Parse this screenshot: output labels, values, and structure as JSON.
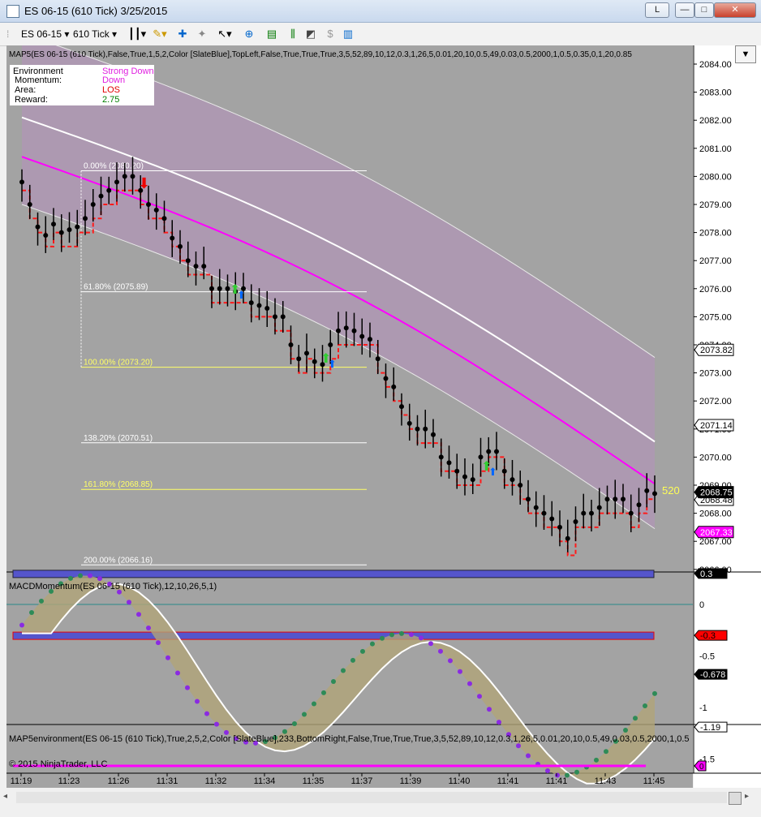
{
  "window": {
    "title": "ES 06-15 (610 Tick)  3/25/2015",
    "btn_l": "L",
    "btn_min": "—",
    "btn_max": "□",
    "btn_close": "✕"
  },
  "toolbar": {
    "instrument": "ES 06-15",
    "interval": "610 Tick"
  },
  "chart": {
    "indicator_map5": "MAP5(ES 06-15 (610 Tick),False,True,1,5,2,Color [SlateBlue],TopLeft,False,True,True,True,3,5,52,89,10,12,0.3,1,26,5,0.01,20,10,0.5,49,0.03,0.5,2000,1,0.5,0.35,0,1,20,0.85",
    "indicator_macd": "MACDMomentum(ES 06-15 (610 Tick),12,10,26,5,1)",
    "indicator_env": "MAP5environment(ES 06-15 (610 Tick),True,2,5,2,Color [SlateBlue],233,BottomRight,False,True,True,True,3,5,52,89,10,12,0.3,1,26,5,0.01,20,10,0.5,49,0.03,0.5,2000,1,0.5",
    "copyright": "© 2015 NinjaTrader, LLC",
    "bar_counter": "520",
    "info": {
      "environment_label": "Environment",
      "environment_value": "Strong Down",
      "momentum_label": "Momentum:",
      "momentum_value": "Down",
      "area_label": "Area:",
      "area_value": "LOS",
      "reward_label": "Reward:",
      "reward_value": "2.75"
    },
    "fib_labels": [
      {
        "level": 2080.2,
        "text": "0.00% (2080.20)"
      },
      {
        "level": 2075.89,
        "text": "61.80% (2075.89)"
      },
      {
        "level": 2073.2,
        "text": "100.00% (2073.20)"
      },
      {
        "level": 2070.51,
        "text": "138.20% (2070.51)"
      },
      {
        "level": 2068.85,
        "text": "161.80% (2068.85)"
      },
      {
        "level": 2066.16,
        "text": "200.00% (2066.16)"
      }
    ],
    "price_ticks": [
      "2084.00",
      "2083.00",
      "2082.00",
      "2081.00",
      "2080.00",
      "2079.00",
      "2078.00",
      "2077.00",
      "2076.00",
      "2075.00",
      "2074.00",
      "2073.00",
      "2072.00",
      "2071.00",
      "2070.00",
      "2069.00",
      "2068.00",
      "2067.00",
      "2066.00"
    ],
    "price_tags": [
      {
        "value": 2073.82,
        "text": "2073.82",
        "style": "white"
      },
      {
        "value": 2071.14,
        "text": "2071.14",
        "style": "white"
      },
      {
        "value": 2068.48,
        "text": "2068.48",
        "style": "white"
      },
      {
        "value": 2068.75,
        "text": "2068.75",
        "style": "black"
      },
      {
        "value": 2067.33,
        "text": "2067.33",
        "style": "magenta"
      }
    ],
    "macd_ticks": [
      "0",
      "-0.5",
      "-1",
      "-1.5"
    ],
    "macd_tags": [
      {
        "value": 0.3,
        "text": "0.3",
        "style": "black"
      },
      {
        "value": -0.3,
        "text": "-0.3",
        "style": "red"
      },
      {
        "value": -0.678,
        "text": "-0.678",
        "style": "black"
      },
      {
        "value": -1.19,
        "text": "-1.19",
        "style": "white"
      }
    ],
    "env_tag": "0",
    "time_labels": [
      "11:19",
      "11:23",
      "11:26",
      "11:31",
      "11:32",
      "11:34",
      "11:35",
      "11:37",
      "11:39",
      "11:40",
      "11:41",
      "11:41",
      "11:43",
      "11:45"
    ]
  },
  "chart_data": {
    "type": "candlestick",
    "price_range": [
      2065.8,
      2084.5
    ],
    "close_series": [
      2079.8,
      2079.0,
      2078.2,
      2077.9,
      2078.3,
      2078.0,
      2078.1,
      2078.2,
      2078.5,
      2079.0,
      2079.3,
      2079.5,
      2079.8,
      2080.0,
      2080.0,
      2079.5,
      2079.0,
      2078.8,
      2078.5,
      2077.8,
      2077.5,
      2077.0,
      2076.8,
      2076.8,
      2076.0,
      2076.0,
      2076.0,
      2075.9,
      2076.0,
      2075.5,
      2075.4,
      2075.3,
      2075.0,
      2075.0,
      2074.0,
      2073.5,
      2073.7,
      2073.4,
      2073.3,
      2074.0,
      2074.5,
      2074.6,
      2074.5,
      2074.3,
      2074.2,
      2073.5,
      2072.8,
      2072.5,
      2071.8,
      2071.2,
      2071.0,
      2071.0,
      2070.8,
      2070.0,
      2069.8,
      2069.5,
      2069.3,
      2069.2,
      2070.0,
      2070.2,
      2070.2,
      2069.5,
      2069.2,
      2069.0,
      2068.5,
      2068.2,
      2068.0,
      2067.8,
      2067.5,
      2067.1,
      2067.7,
      2068.0,
      2068.0,
      2068.2,
      2068.5,
      2068.5,
      2068.5,
      2068.0,
      2068.3,
      2068.8,
      2068.7
    ],
    "macd_range": [
      -1.7,
      0.45
    ]
  }
}
